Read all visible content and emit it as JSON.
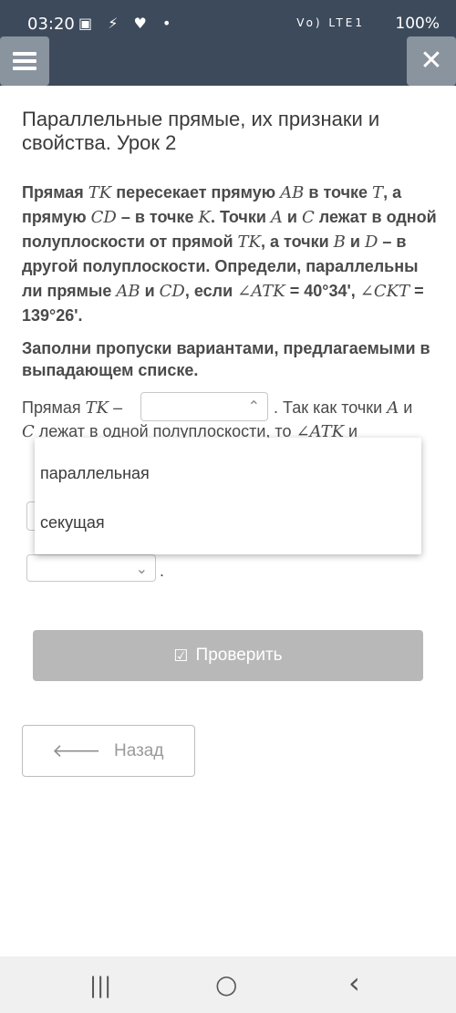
{
  "status_bar": {
    "time": "03:20",
    "left_icons": "▣ ⚡ ♥ •",
    "signal": "Vo) LTE1",
    "battery": "100%"
  },
  "header": {
    "menu_icon": "hamburger-icon",
    "close_icon": "close-icon",
    "close_glyph": "✕"
  },
  "lesson": {
    "title": "Параллельные прямые, их признаки и свойства. Урок 2"
  },
  "question": {
    "text_parts": {
      "p1": "Прямая ",
      "m1": "TK",
      "p2": " пересекает прямую ",
      "m2": "AB",
      "p3": " в точке ",
      "m3": "T",
      "p4": ", а прямую ",
      "m4": "CD",
      "p5": " – в точке ",
      "m5": "K",
      "p6": ". Точки ",
      "m6": "A",
      "p7": " и ",
      "m7": "C",
      "p8": " лежат в одной полуплоскости от прямой ",
      "m8": "TK",
      "p9": ", а точки ",
      "m9": "B",
      "p10": " и ",
      "m10": "D",
      "p11": " – в другой полуплоскости. Определи, параллельны ли прямые ",
      "m11": "AB",
      "p12": " и ",
      "m12": "CD",
      "p13": ", если ",
      "m13": "∠ATK",
      "p14": " = 40°34', ",
      "m14": "∠CKT",
      "p15": " = 139°26'."
    },
    "instruction": "Заполни пропуски вариантами, предлагаемыми в выпадающем списке."
  },
  "fill_in": {
    "line1_prefix": "Прямая ",
    "line1_math": "TK",
    "line1_dash": " –",
    "line1_suffix": ". Так как точки ",
    "line1_m2": "A",
    "line1_and": " и",
    "line2_m": "C",
    "line2_text": " лежат в одной полуплоскости, то ",
    "line2_m2": "∠ATK",
    "line2_and": " и",
    "select1_chevron": "⌃",
    "select3_chevron": "⌄",
    "end_dot": "."
  },
  "dropdown": {
    "options": [
      "параллельная",
      "секущая"
    ]
  },
  "buttons": {
    "check_icon": "check-square-icon",
    "check_glyph": "☑",
    "check_label": "Проверить",
    "back_icon": "arrow-left-icon",
    "back_glyph": "🡐",
    "back_label": "Назад"
  },
  "nav": {
    "recent": "|||",
    "home": "○",
    "back": "‹"
  }
}
